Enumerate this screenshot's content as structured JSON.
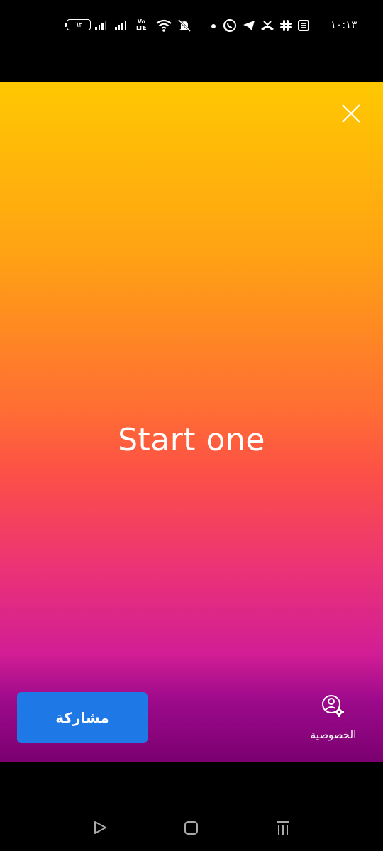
{
  "status_bar": {
    "battery": "٦٢",
    "volte_top": "Vo",
    "volte_bottom": "LTE",
    "time": "١٠:١٣",
    "icons": [
      "battery-icon",
      "signal-icon",
      "signal-icon",
      "volte-icon",
      "wifi-icon",
      "mute-icon",
      "dot-icon",
      "whatsapp-icon",
      "telegram-icon",
      "missed-call-icon",
      "slack-icon",
      "news-icon"
    ]
  },
  "main": {
    "text": "Start one",
    "gradient_colors": [
      "#ffc801",
      "#ffa114",
      "#ff6e33",
      "#fc4f48",
      "#ea3277",
      "#d21d95",
      "#7b0070"
    ],
    "close_icon": "close-icon"
  },
  "actions": {
    "share_label": "مشاركة",
    "share_color": "#1e79e6",
    "privacy_label": "الخصوصية",
    "privacy_icon": "privacy-settings-icon"
  },
  "nav_bar": {
    "buttons": [
      "back-icon",
      "home-icon",
      "recents-icon"
    ]
  }
}
